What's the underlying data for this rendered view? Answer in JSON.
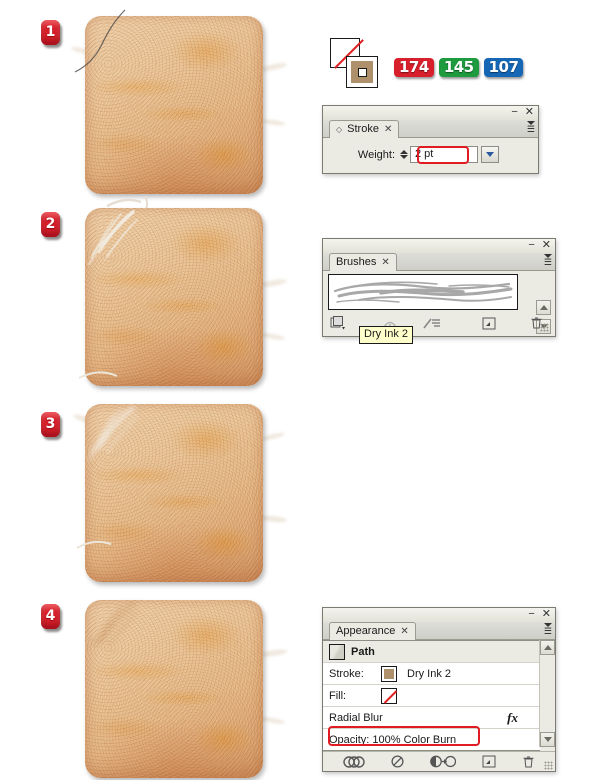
{
  "steps": [
    {
      "number": "1",
      "name": "step-1"
    },
    {
      "number": "2",
      "name": "step-2"
    },
    {
      "number": "3",
      "name": "step-3"
    },
    {
      "number": "4",
      "name": "step-4"
    }
  ],
  "color_indicator": {
    "fill_icon": "none-fill-icon",
    "stroke_icon": "stroke-swatch-icon",
    "stroke_color": "#ae916b",
    "none_slash_color": "#e02020"
  },
  "rgb": {
    "r_label": "174",
    "g_label": "145",
    "b_label": "107",
    "r_color": "#d8202c",
    "g_color": "#1d9b3e",
    "b_color": "#1567b5"
  },
  "stroke_panel": {
    "tab_label": "Stroke",
    "close_glyph": "✕",
    "minimize_glyph": "−",
    "weight_label": "Weight:",
    "weight_value": "2 pt",
    "highlight_color": "#e11b22"
  },
  "brushes_panel": {
    "tab_label": "Brushes",
    "close_glyph": "✕",
    "minimize_glyph": "−",
    "tooltip": "Dry Ink 2",
    "toolbar_icons": [
      "brush-libraries-icon",
      "remove-brush-link-icon",
      "options-of-selected-object-icon",
      "new-brush-icon",
      "delete-brush-icon"
    ]
  },
  "appearance_panel": {
    "tab_label": "Appearance",
    "close_glyph": "✕",
    "minimize_glyph": "−",
    "rows": [
      {
        "name": "path-row",
        "label": "Path"
      },
      {
        "name": "stroke-row",
        "label": "Stroke:",
        "value": "Dry Ink 2"
      },
      {
        "name": "fill-row",
        "label": "Fill:",
        "value": ""
      },
      {
        "name": "radial-blur-row",
        "label": "Radial Blur",
        "fx": "fx"
      },
      {
        "name": "opacity-row",
        "label": "Opacity: 100% Color Burn"
      }
    ],
    "toolbar_icons": [
      "add-new-stroke-icon",
      "clear-appearance-icon",
      "duplicate-selected-item-icon",
      "new-art-has-basic-appearance-icon",
      "delete-selected-item-icon"
    ],
    "highlight_color": "#e11b22"
  }
}
